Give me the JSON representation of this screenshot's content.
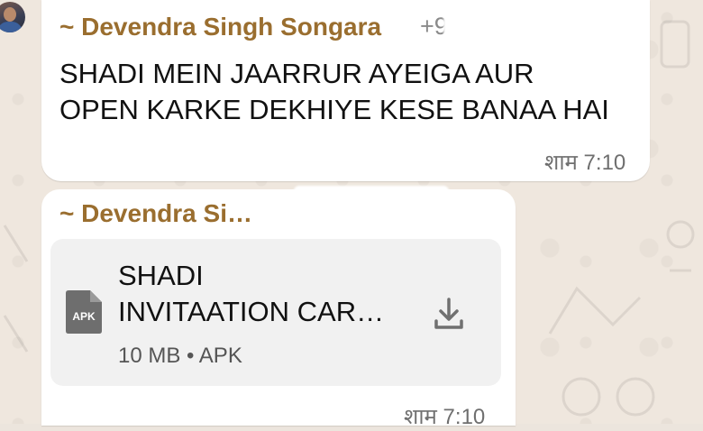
{
  "messages": [
    {
      "sender": "~ Devendra Singh Songara",
      "phone_fragment": "+9",
      "text": "SHADI MEIN JAARRUR AYEIGA AUR OPEN KARKE DEKHIYE KESE BANAA HAI",
      "time": "शाम 7:10",
      "icon": "avatar"
    },
    {
      "sender": "~ Devendra Si…",
      "attachment": {
        "name_line1": "SHADI",
        "name_line2": "INVITAATION CAR…",
        "type_badge": "APK",
        "size": "10 MB",
        "separator": "•",
        "type": "APK",
        "icon": "apk-file-icon",
        "action_icon": "download-icon"
      },
      "time": "शाम 7:10"
    }
  ],
  "colors": {
    "sender": "#9a6e2f",
    "bubble": "#ffffff",
    "wallpaper": "#efe7de",
    "file_card": "#f1f1f1",
    "time": "#6f6f6f",
    "apk_icon": "#6e6e6e"
  }
}
